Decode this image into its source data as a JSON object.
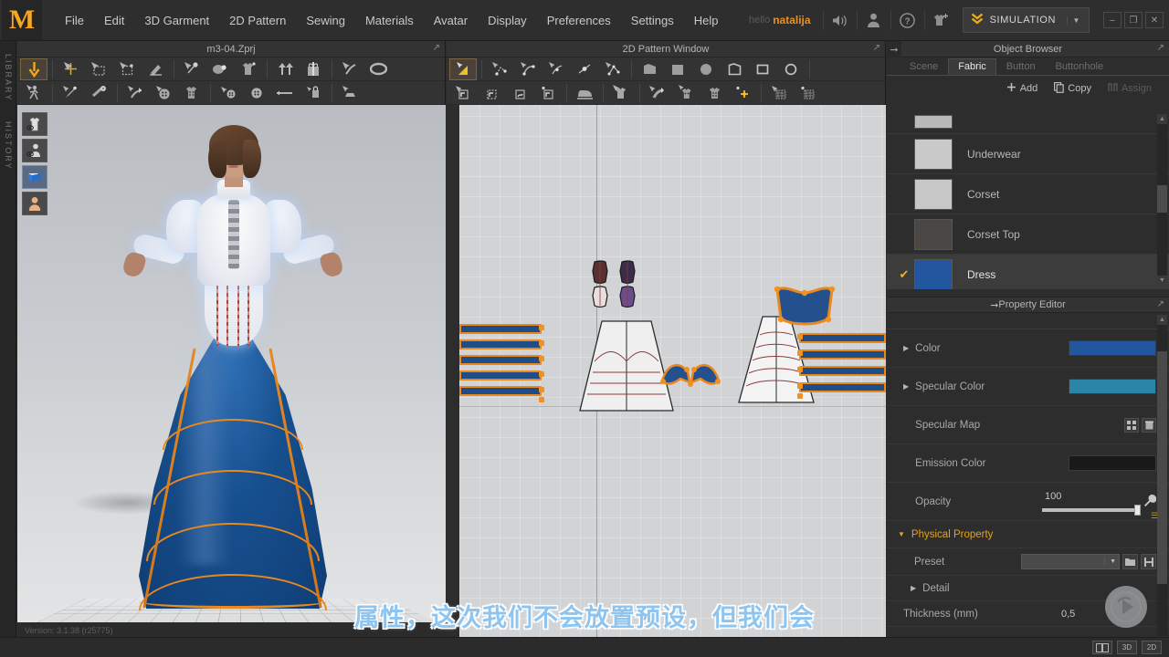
{
  "app": {
    "logo": "M",
    "version_text": "Version: 3.1.38 (r25775)"
  },
  "menubar": {
    "items": [
      {
        "label": "File"
      },
      {
        "label": "Edit"
      },
      {
        "label": "3D Garment"
      },
      {
        "label": "2D Pattern"
      },
      {
        "label": "Sewing"
      },
      {
        "label": "Materials"
      },
      {
        "label": "Avatar"
      },
      {
        "label": "Display"
      },
      {
        "label": "Preferences"
      },
      {
        "label": "Settings"
      },
      {
        "label": "Help"
      }
    ],
    "hello_text": "hello",
    "username": "natalija",
    "icons": [
      "speaker-icon",
      "user-icon",
      "help-icon",
      "garment-add-icon"
    ],
    "simulation": {
      "label": "SIMULATION",
      "chevron": "»",
      "dropdown": "▼"
    },
    "window_controls": {
      "minimize": "–",
      "restore": "❐",
      "close": "✕"
    }
  },
  "leftrail": {
    "tabs": [
      "LIBRARY",
      "HISTORY"
    ]
  },
  "view3d": {
    "title": "m3-04.Zprj",
    "popout": "↗",
    "viewtools": [
      {
        "name": "show-garment-toggle",
        "on": false
      },
      {
        "name": "show-avatar-toggle",
        "on": false
      },
      {
        "name": "show-texture-toggle",
        "on": true
      },
      {
        "name": "show-skin-toggle",
        "on": false
      }
    ],
    "status": "Version: 3.1.38 (r25775)"
  },
  "view2d": {
    "title": "2D Pattern Window",
    "popout": "↗"
  },
  "object_browser": {
    "title": "Object Browser",
    "popout": "↗",
    "tabs": [
      {
        "label": "Scene",
        "active": false
      },
      {
        "label": "Fabric",
        "active": true
      },
      {
        "label": "Button",
        "active": false
      },
      {
        "label": "Buttonhole",
        "active": false
      }
    ],
    "actions": [
      {
        "label": "Add",
        "icon": "plus-icon",
        "disabled": false
      },
      {
        "label": "Copy",
        "icon": "copy-icon",
        "disabled": false
      },
      {
        "label": "Assign",
        "icon": "assign-icon",
        "disabled": true
      }
    ],
    "fabrics": [
      {
        "name": "",
        "color": "#b9b9b9",
        "selected": false
      },
      {
        "name": "Underwear",
        "color": "#c9c9c9",
        "selected": false
      },
      {
        "name": "Corset",
        "color": "#c7c7c7",
        "selected": false
      },
      {
        "name": "Corset Top",
        "color": "#4a4744",
        "selected": false
      },
      {
        "name": "Dress",
        "color": "#2255a4",
        "selected": true,
        "check": "✔"
      }
    ]
  },
  "property_editor": {
    "title": "Property Editor",
    "popout": "↗",
    "rows": [
      {
        "label": "Color",
        "type": "color",
        "value": "#22569f",
        "expandable": true
      },
      {
        "label": "Specular Color",
        "type": "color",
        "value": "#2a85a8",
        "expandable": true
      },
      {
        "label": "Specular Map",
        "type": "map",
        "icons": [
          "grid-icon",
          "trash-icon"
        ]
      },
      {
        "label": "Emission Color",
        "type": "color",
        "value": "#191919",
        "expandable": false
      }
    ],
    "opacity": {
      "label": "Opacity",
      "value": "100",
      "percent": 100,
      "tool_icon": "wrench-icon"
    },
    "physical_property": {
      "label": "Physical Property",
      "expanded": true
    },
    "preset": {
      "label": "Preset",
      "value": "",
      "dropdown": "▼",
      "icons": [
        "open-folder-icon",
        "save-icon"
      ]
    },
    "detail": {
      "label": "Detail",
      "expanded": false
    },
    "thickness": {
      "label": "Thickness (mm)",
      "value": "0,5"
    }
  },
  "bottombar": {
    "buttons": [
      {
        "label": "▣",
        "name": "split-view-button"
      },
      {
        "label": "3D",
        "name": "view-3d-button"
      },
      {
        "label": "2D",
        "name": "view-2d-button"
      }
    ]
  },
  "subtitle": {
    "text": "属性，这次我们不会放置预设，但我们会"
  },
  "colors": {
    "accent": "#e8a317",
    "dress_blue": "#22569f",
    "pattern_outline": "#e8881e"
  }
}
